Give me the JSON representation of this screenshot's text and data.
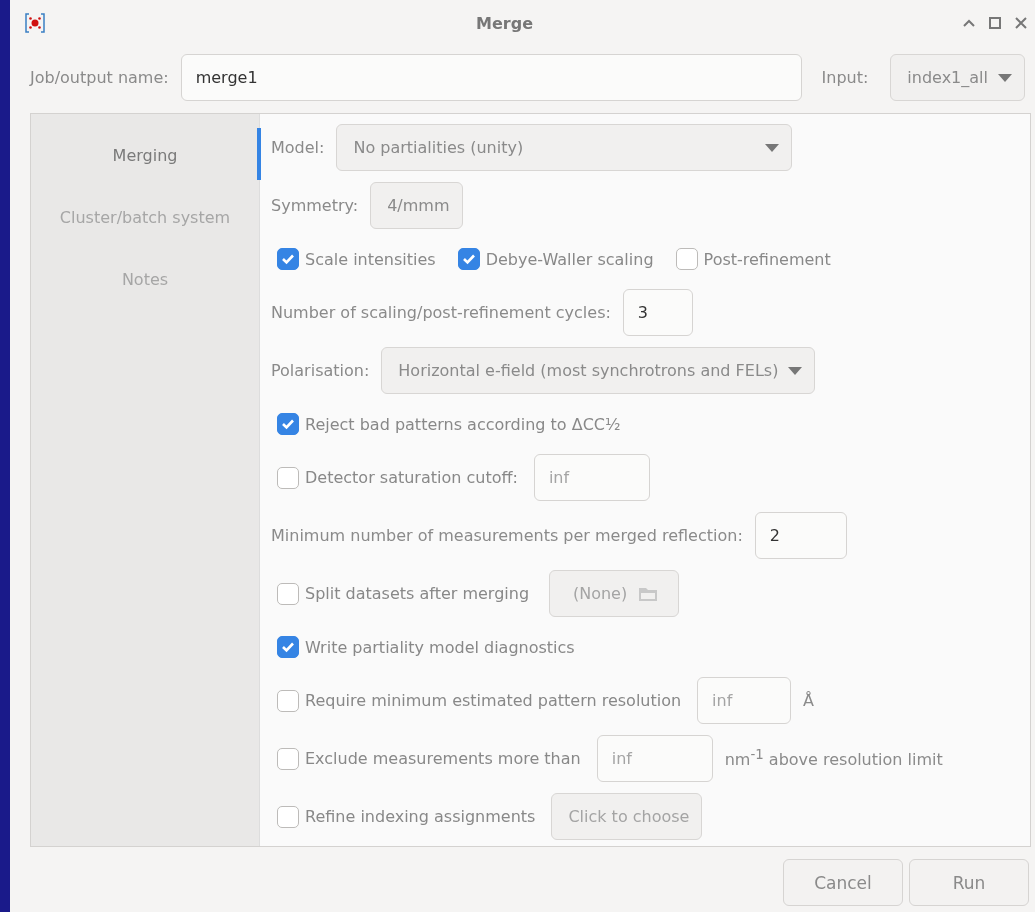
{
  "window": {
    "title": "Merge"
  },
  "job": {
    "label": "Job/output name:",
    "value": "merge1"
  },
  "input": {
    "label": "Input:",
    "value": "index1_all"
  },
  "sidebar": {
    "items": [
      {
        "label": "Merging",
        "selected": true
      },
      {
        "label": "Cluster/batch system",
        "selected": false
      },
      {
        "label": "Notes",
        "selected": false
      }
    ]
  },
  "rows": [
    {
      "kind": "dropdown",
      "label": "Model:",
      "value": "No partialities (unity)"
    },
    {
      "kind": "button",
      "label": "Symmetry:",
      "value": "4/mmm"
    },
    {
      "kind": "checks",
      "items": [
        {
          "label": "Scale intensities",
          "checked": true
        },
        {
          "label": "Debye-Waller scaling",
          "checked": true
        },
        {
          "label": "Post-refinement",
          "checked": false
        }
      ]
    },
    {
      "kind": "number",
      "label": "Number of scaling/post-refinement cycles:",
      "value": "3"
    },
    {
      "kind": "dropdown",
      "label": "Polarisation:",
      "value": "Horizontal e-field (most synchrotrons and FELs)"
    },
    {
      "kind": "check",
      "label": "Reject bad patterns according to ΔCC½",
      "checked": true
    },
    {
      "kind": "check_field",
      "label": "Detector saturation cutoff:",
      "checked": false,
      "value": "inf"
    },
    {
      "kind": "number",
      "label": "Minimum number of measurements per merged reflection:",
      "value": "2"
    },
    {
      "kind": "check_file",
      "label": "Split datasets after merging",
      "checked": false,
      "value": "(None)"
    },
    {
      "kind": "check",
      "label": "Write partiality model diagnostics",
      "checked": true
    },
    {
      "kind": "check_field",
      "label": "Require minimum estimated pattern resolution",
      "checked": false,
      "value": "inf",
      "suffix": "Å"
    },
    {
      "kind": "check_field",
      "label": "Exclude measurements more than",
      "checked": false,
      "value": "inf",
      "suffix": "nm$^{-1}$ above resolution limit"
    },
    {
      "kind": "check_button",
      "label": "Refine indexing assignments",
      "checked": false,
      "value": "Click to choose"
    }
  ],
  "buttons": [
    "Cancel",
    "Run"
  ]
}
